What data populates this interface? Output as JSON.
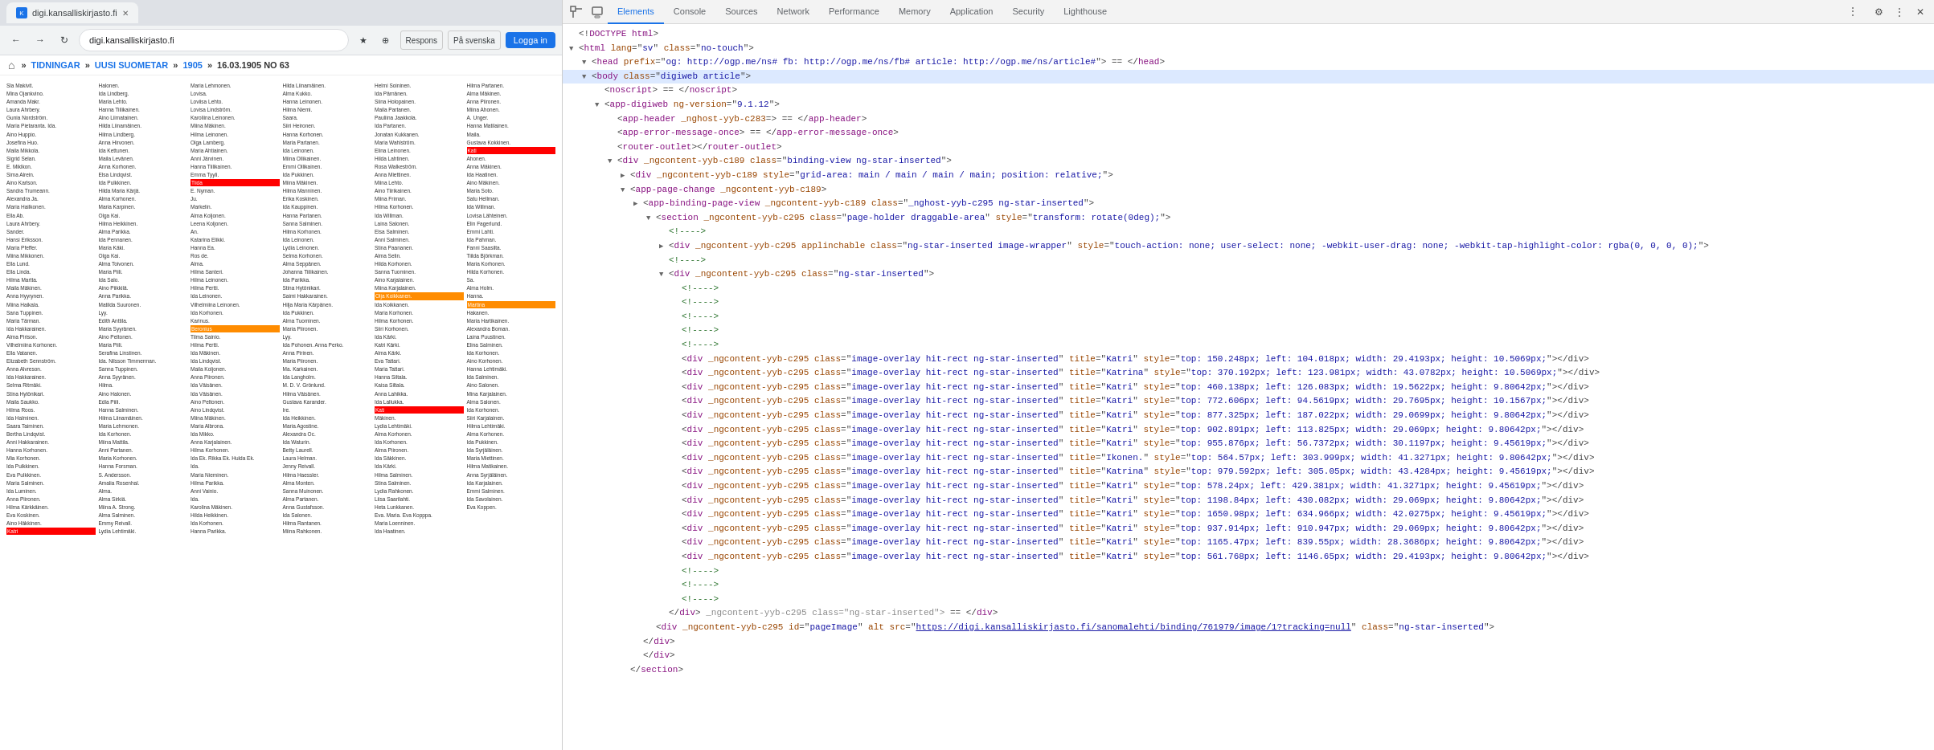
{
  "browser": {
    "tab_label": "digi.kansalliskirjasto.fi",
    "tab_favicon": "K",
    "url": "digi.kansalliskirjasto.fi",
    "nav_back": "←",
    "nav_forward": "→",
    "nav_refresh": "↻",
    "toolbar_buttons": [
      "↕",
      "★",
      "⊕"
    ],
    "respond_btn": "Respons",
    "language_btn": "På svenska",
    "login_btn": "Logga in"
  },
  "page": {
    "breadcrumb_home": "⌂",
    "breadcrumb_separator": "»",
    "breadcrumb_items": [
      "TIDNINGAR",
      "UUSI SUOMETAR",
      "1905",
      "16.03.1905 NO 63"
    ],
    "year": "1905"
  },
  "devtools": {
    "icon_inspect": "⬚",
    "icon_mobile": "□",
    "tabs": [
      "Elements",
      "Console",
      "Sources",
      "Network",
      "Performance",
      "Memory",
      "Application",
      "Security",
      "Lighthouse"
    ],
    "active_tab": "Elements",
    "more_icon": "⋮",
    "close_icon": "✕"
  },
  "dom_lines": [
    {
      "indent": 0,
      "tri": "none",
      "content": "<!DOCTYPE html>",
      "type": "doctype"
    },
    {
      "indent": 0,
      "tri": "open",
      "content": "<html lang=\"sv\" class=\"no-touch\">",
      "type": "tag"
    },
    {
      "indent": 1,
      "tri": "open",
      "content": "<head prefix=\"og: http://ogp.me/ns# fb: http://ogp.me/ns/fb# article: http://ogp.me/ns/article#\"> == </head>",
      "type": "tag"
    },
    {
      "indent": 1,
      "tri": "open",
      "content": "<body class=\"digiweb article\">",
      "type": "tag",
      "selected": true
    },
    {
      "indent": 2,
      "tri": "none",
      "content": "<noscript> == </noscript>",
      "type": "tag"
    },
    {
      "indent": 2,
      "tri": "open",
      "content": "<app-digiweb ng-version=\"9.1.12\">",
      "type": "tag"
    },
    {
      "indent": 3,
      "tri": "none",
      "content": "<app-header _nghost-yyb-c283=> == </app-header>",
      "type": "tag"
    },
    {
      "indent": 3,
      "tri": "none",
      "content": "<app-error-message-once> == </app-error-message-once>",
      "type": "tag"
    },
    {
      "indent": 3,
      "tri": "none",
      "content": "<router-outlet></router-outlet>",
      "type": "tag"
    },
    {
      "indent": 3,
      "tri": "open",
      "content": "<div _ngcontent-yyb-c189 class=\"binding-view ng-star-inserted\">",
      "type": "tag"
    },
    {
      "indent": 4,
      "tri": "closed",
      "content": "<div _ngcontent-yyb-c189 style=\"grid-area: main / main / main / main; position: relative;\">",
      "type": "tag"
    },
    {
      "indent": 4,
      "tri": "open",
      "content": "<app-page-change _ngcontent-yyb-c189>",
      "type": "tag"
    },
    {
      "indent": 5,
      "tri": "closed",
      "content": "<app-binding-page-view _ngcontent-yyb-c189 class=\"_nghost-yyb-c295 ng-star-inserted\">",
      "type": "tag"
    },
    {
      "indent": 6,
      "tri": "open",
      "content": "<section _ngcontent-yyb-c295 class=\"page-holder draggable-area\" style=\"transform: rotate(0deg);\">",
      "type": "tag"
    },
    {
      "indent": 7,
      "tri": "none",
      "content": "<!----> ",
      "type": "comment"
    },
    {
      "indent": 7,
      "tri": "closed",
      "content": "<div _ngcontent-yyb-c295 applinchable class=\"ng-star-inserted image-wrapper\" style=\"touch-action: none; user-select: none; -webkit-user-drag: none; -webkit-tap-highlight-color: rgba(0, 0, 0, 0);\">",
      "type": "tag"
    },
    {
      "indent": 7,
      "tri": "none",
      "content": "<!---->",
      "type": "comment"
    },
    {
      "indent": 7,
      "tri": "open",
      "content": "<div _ngcontent-yyb-c295 class=\"ng-star-inserted\">",
      "type": "tag"
    },
    {
      "indent": 8,
      "tri": "none",
      "content": "<!----> ",
      "type": "comment"
    },
    {
      "indent": 8,
      "tri": "none",
      "content": "<!----> ",
      "type": "comment"
    },
    {
      "indent": 8,
      "tri": "none",
      "content": "<!----> ",
      "type": "comment"
    },
    {
      "indent": 8,
      "tri": "none",
      "content": "<!----> ",
      "type": "comment"
    },
    {
      "indent": 8,
      "tri": "none",
      "content": "<!----> ",
      "type": "comment"
    },
    {
      "indent": 8,
      "tri": "none",
      "content": "<div _ngcontent-yyb-c295 class=\"image-overlay hit-rect ng-star-inserted\" title=\"Katri\" style=\"top: 150.248px; left: 104.018px; width: 29.4193px; height: 10.5069px;\"></div>",
      "type": "tag"
    },
    {
      "indent": 8,
      "tri": "none",
      "content": "<div _ngcontent-yyb-c295 class=\"image-overlay hit-rect ng-star-inserted\" title=\"Katrina\" style=\"top: 370.192px; left: 123.981px; width: 43.0782px; height: 10.5069px;\"></div>",
      "type": "tag"
    },
    {
      "indent": 8,
      "tri": "none",
      "content": "<div _ngcontent-yyb-c295 class=\"image-overlay hit-rect ng-star-inserted\" title=\"Katri\" style=\"top: 460.138px; left: 126.083px; width: 19.5622px; height: 9.80642px;\"></div>",
      "type": "tag"
    },
    {
      "indent": 8,
      "tri": "none",
      "content": "<div _ngcontent-yyb-c295 class=\"image-overlay hit-rect ng-star-inserted\" title=\"Katri\" style=\"top: 772.606px; left: 94.5619px; width: 29.7695px; height: 10.1567px;\"></div>",
      "type": "tag"
    },
    {
      "indent": 8,
      "tri": "none",
      "content": "<div _ngcontent-yyb-c295 class=\"image-overlay hit-rect ng-star-inserted\" title=\"Katri\" style=\"top: 877.325px; left: 187.022px; width: 29.0699px; height: 9.80642px;\"></div>",
      "type": "tag"
    },
    {
      "indent": 8,
      "tri": "none",
      "content": "<div _ngcontent-yyb-c295 class=\"image-overlay hit-rect ng-star-inserted\" title=\"Katri\" style=\"top: 902.891px; left: 113.825px; width: 29.069px; height: 9.80642px;\"></div>",
      "type": "tag"
    },
    {
      "indent": 8,
      "tri": "none",
      "content": "<div _ngcontent-yyb-c295 class=\"image-overlay hit-rect ng-star-inserted\" title=\"Katri\" style=\"top: 955.876px; left: 56.7372px; width: 30.1197px; height: 9.45619px;\"></div>",
      "type": "tag"
    },
    {
      "indent": 8,
      "tri": "none",
      "content": "<div _ngcontent-yyb-c295 class=\"image-overlay hit-rect ng-star-inserted\" title=\"Ikonen.\" style=\"top: 564.57px; left: 303.999px; width: 41.3271px; height: 9.80642px;\"></div>",
      "type": "tag"
    },
    {
      "indent": 8,
      "tri": "none",
      "content": "<div _ngcontent-yyb-c295 class=\"image-overlay hit-rect ng-star-inserted\" title=\"Katrina\" style=\"top: 979.592px; left: 305.05px; width: 43.4284px; height: 9.45619px;\"></div>",
      "type": "tag"
    },
    {
      "indent": 8,
      "tri": "none",
      "content": "<div _ngcontent-yyb-c295 class=\"image-overlay hit-rect ng-star-inserted\" title=\"Katri\" style=\"top: 578.24px; left: 429.381px; width: 41.3271px; height: 9.45619px;\"></div>",
      "type": "tag"
    },
    {
      "indent": 8,
      "tri": "none",
      "content": "<div _ngcontent-yyb-c295 class=\"image-overlay hit-rect ng-star-inserted\" title=\"Katri\" style=\"top: 1198.84px; left: 430.082px; width: 29.069px; height: 9.80642px;\"></div>",
      "type": "tag"
    },
    {
      "indent": 8,
      "tri": "none",
      "content": "<div _ngcontent-yyb-c295 class=\"image-overlay hit-rect ng-star-inserted\" title=\"Katri\" style=\"top: 1650.98px; left: 634.966px; width: 42.0275px; height: 9.45619px;\"></div>",
      "type": "tag"
    },
    {
      "indent": 8,
      "tri": "none",
      "content": "<div _ngcontent-yyb-c295 class=\"image-overlay hit-rect ng-star-inserted\" title=\"Katri\" style=\"top: 937.914px; left: 910.947px; width: 29.069px; height: 9.80642px;\"></div>",
      "type": "tag"
    },
    {
      "indent": 8,
      "tri": "none",
      "content": "<div _ngcontent-yyb-c295 class=\"image-overlay hit-rect ng-star-inserted\" title=\"Katri\" style=\"top: 1165.47px; left: 839.55px; width: 28.3686px; height: 9.80642px;\"></div>",
      "type": "tag"
    },
    {
      "indent": 8,
      "tri": "none",
      "content": "<div _ngcontent-yyb-c295 class=\"image-overlay hit-rect ng-star-inserted\" title=\"Katri\" style=\"top: 561.768px; left: 1146.65px; width: 29.4193px; height: 9.80642px;\"></div>",
      "type": "tag"
    },
    {
      "indent": 8,
      "tri": "none",
      "content": "<!----> ",
      "type": "comment"
    },
    {
      "indent": 8,
      "tri": "none",
      "content": "<!----> ",
      "type": "comment"
    },
    {
      "indent": 8,
      "tri": "none",
      "content": "<!----> ",
      "type": "comment"
    },
    {
      "indent": 7,
      "tri": "none",
      "content": "</div> _ngcontent-yyb-c295 class=\"ng-star-inserted\"> == </div>",
      "type": "tag"
    },
    {
      "indent": 6,
      "tri": "none",
      "content": "<div _ngcontent-yyb-c295 id=\"pageImage\" alt src=\"https://digi.kansalliskirjasto.fi/sanomalehti/binding/761979/image/1?tracking=null\" class=\"ng-star-inserted\">",
      "type": "tag",
      "link": true
    },
    {
      "indent": 5,
      "tri": "none",
      "content": "</div>",
      "type": "tag"
    },
    {
      "indent": 5,
      "tri": "none",
      "content": "</div>",
      "type": "tag"
    },
    {
      "indent": 4,
      "tri": "none",
      "content": "</section>",
      "type": "tag"
    }
  ],
  "names_data": {
    "sample_text": "Sla Makivit. Mina Ojankvino. Amanda Makr. Laura Ahrbery. Gunia Nordström. Maria Pletaranta. Ida. Aino Huppio. Josefina Huo. Maila Mikkola. Sigrid Selan. E. Miklkon. Sima Alrein. Aino Karlson. Sandra Trumeann. Alexandra Ja..."
  }
}
